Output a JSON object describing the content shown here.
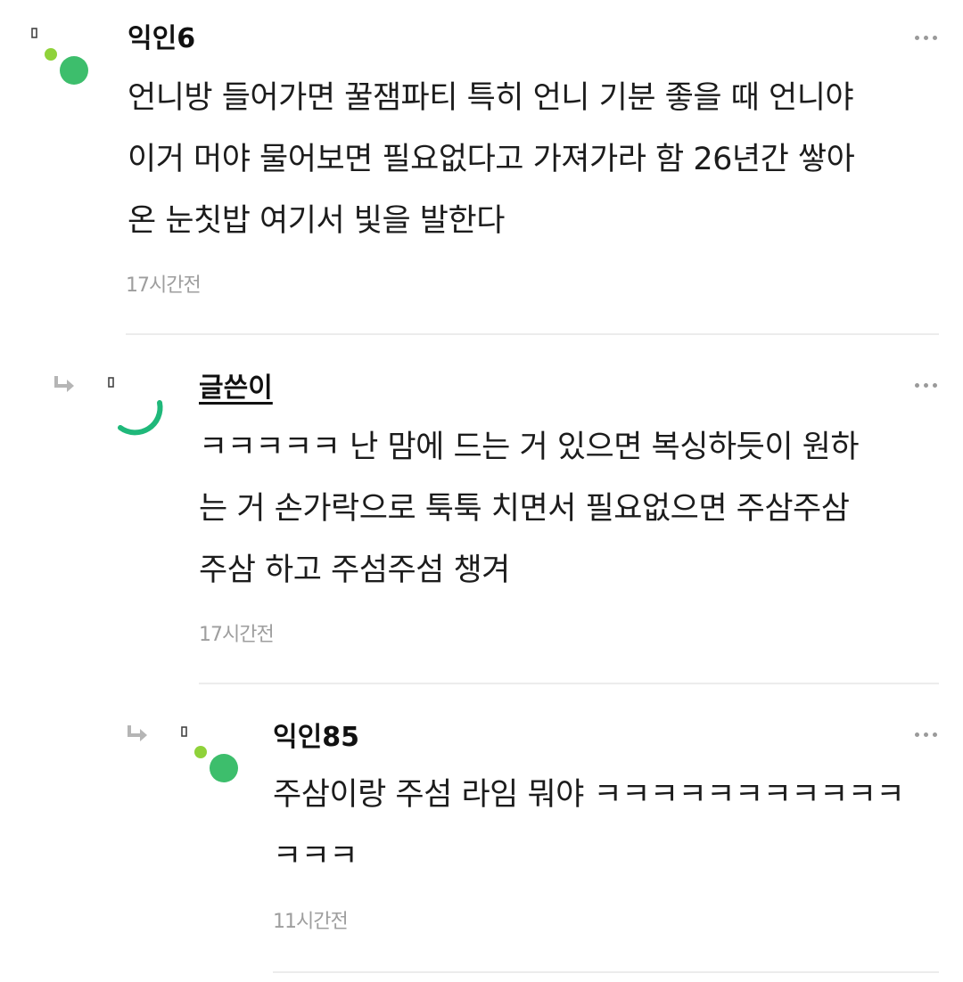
{
  "comments": [
    {
      "author": "익인6",
      "text": "언니방 들어가면 꿀잼파티 특히 언니 기분 좋을 때 언니야\n이거 머야 물어보면 필요없다고 가져가라 함 26년간 쌓아\n온 눈칫밥 여기서 빛을 발한다",
      "time": "17시간전"
    },
    {
      "author": "글쓴이",
      "text": "ㅋㅋㅋㅋㅋ 난 맘에 드는 거 있으면 복싱하듯이 원하\n는 거 손가락으로 툭툭 치면서 필요없으면 주삼주삼\n주삼 하고 주섬주섬 챙겨",
      "time": "17시간전"
    },
    {
      "author": "익인85",
      "text": "주삼이랑 주섬 라임 뭐야 ㅋㅋㅋㅋㅋㅋㅋㅋㅋㅋㅋ\nㅋㅋㅋ",
      "time": "11시간전"
    }
  ],
  "colors": {
    "avatar_green": "#3dbe6c",
    "avatar_lime": "#8fd23a",
    "op_arc": "#1fb87a",
    "reply_arrow": "#b5b5b5",
    "divider": "#ececec",
    "timestamp": "#9e9e9e"
  },
  "icons": {
    "reply": "reply-arrow-icon",
    "more": "more-options-icon"
  }
}
